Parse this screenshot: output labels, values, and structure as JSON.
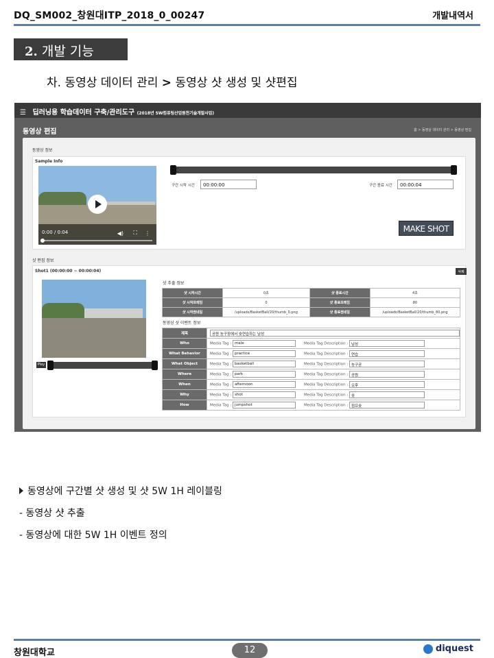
{
  "header": {
    "doc_id": "DQ_SM002_창원대ITP_2018_0_00247",
    "doc_type": "개발내역서"
  },
  "section": {
    "num": "2.",
    "title": "개발 기능"
  },
  "subsection": {
    "prefix": "차.",
    "part1": "동영상 데이터 관리",
    "arrow": ">",
    "part2": "동영상 샷 생성 및 샷편집"
  },
  "screenshot": {
    "menu_icon": "hamburger-icon",
    "app_title": "딥러닝용 학습데이터 구축/관리도구",
    "app_subtitle": "(2018년 SW컴퓨팅산업원천기술개발사업)",
    "page_title": "동영상 편집",
    "breadcrumb": "홈 > 동영상 데이터 관리 > 동영상 편집",
    "video_info_label": "동영상 정보",
    "sample_info_label": "Sample Info",
    "player_time": "0:00 / 0:04",
    "start_label": "구간 시작 시간",
    "start_value": "00:00:00",
    "end_label": "구간 종료 시간",
    "end_value": "00:00:04",
    "make_shot": "MAKE SHOT",
    "shot_edit_label": "샷 편집 정보",
    "shot_title": "Shot1 (00:00:00 ~ 00:00:04)",
    "delete_label": "삭제",
    "play_label": "Play",
    "shot_extract_label": "샷 추출 정보",
    "extract_rows": [
      {
        "h1": "샷 시작시간",
        "v1": "0초",
        "h2": "샷 종료시간",
        "v2": "4초"
      },
      {
        "h1": "샷 시작프레임",
        "v1": "0",
        "h2": "샷 종료프레임",
        "v2": "80"
      },
      {
        "h1": "샷 시작썸네일",
        "v1": "/uploads/BasketBall/20/thumb_0.png",
        "h2": "샷 종료썸네일",
        "v2": "/uploads/BasketBall/20/thumb_80.png"
      }
    ],
    "event_label": "동영상 샷 이벤트 정보",
    "title_row": {
      "h": "제목",
      "value": "공원 농구장에서 슛연습하는 남성"
    },
    "tag_label": "Media Tag :",
    "desc_label": "Media Tag Description :",
    "event_rows": [
      {
        "h": "Who",
        "tag": "male",
        "desc": "남성"
      },
      {
        "h": "What Behavior",
        "tag": "practice",
        "desc": "연습"
      },
      {
        "h": "What Object",
        "tag": "basketball",
        "desc": "농구공"
      },
      {
        "h": "Where",
        "tag": "park",
        "desc": "공원"
      },
      {
        "h": "When",
        "tag": "afternoon",
        "desc": "오후"
      },
      {
        "h": "Why",
        "tag": "shot",
        "desc": "슛"
      },
      {
        "h": "How",
        "tag": "jumpshot",
        "desc": "점프슛"
      }
    ]
  },
  "bullets": [
    "동영상에 구간별 샷 생성 및 샷 5W 1H 레이블링",
    "- 동영상 샷 추출",
    "- 동영상에 대한 5W 1H 이벤트 정의"
  ],
  "footer": {
    "university": "창원대학교",
    "page": "12",
    "logo_text": "diquest"
  }
}
